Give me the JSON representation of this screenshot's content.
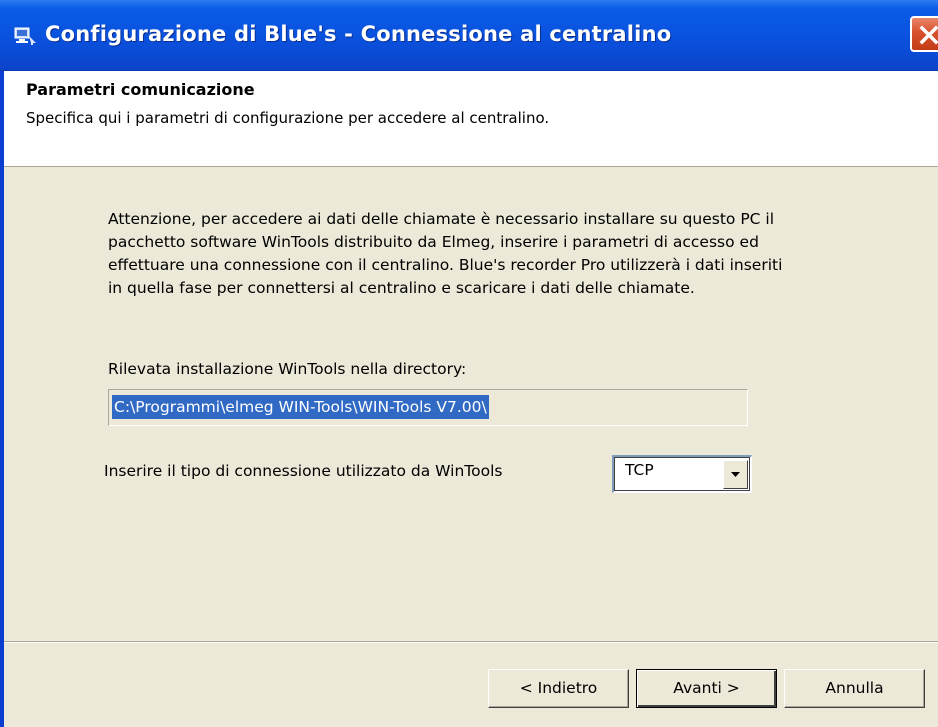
{
  "window": {
    "title": "Configurazione di Blue's - Connessione al centralino",
    "icon": "window-app-icon",
    "close_icon": "close-icon"
  },
  "header": {
    "title": "Parametri comunicazione",
    "subtitle": "Specifica qui i parametri di configurazione per accedere al centralino."
  },
  "body": {
    "paragraph_lines": [
      "Attenzione, per accedere ai dati delle chiamate è necessario installare su questo PC il",
      "pacchetto software WinTools distribuito da Elmeg, inserire i parametri di accesso ed",
      "effettuare una connessione con il centralino.  Blue's recorder Pro utilizzerà i dati inseriti",
      "in quella fase per connettersi al centralino e scaricare i dati delle chiamate."
    ],
    "directory_label": "Rilevata installazione WinTools nella directory:",
    "directory_value": "C:\\Programmi\\elmeg WIN-Tools\\WIN-Tools V7.00\\",
    "connection_label": "Inserire il tipo di connessione utilizzato da WinTools",
    "connection_selected": "TCP"
  },
  "buttons": {
    "back": "< Indietro",
    "next": "Avanti >",
    "cancel": "Annulla"
  },
  "colors": {
    "titlebar": "#0954E0",
    "dialog_bg": "#ECE9D8",
    "selection": "#316AC5",
    "close_button": "#D8522C"
  }
}
